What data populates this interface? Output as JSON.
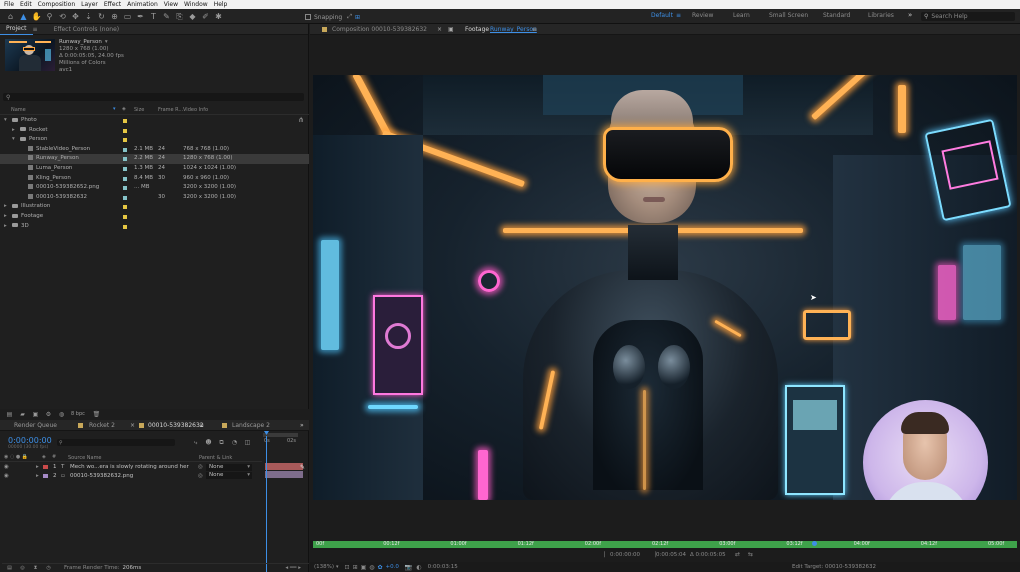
{
  "menu": [
    "File",
    "Edit",
    "Composition",
    "Layer",
    "Effect",
    "Animation",
    "View",
    "Window",
    "Help"
  ],
  "toolbar": {
    "snapping_label": "Snapping",
    "workspaces": [
      "Default",
      "Review",
      "Learn",
      "Small Screen",
      "Standard",
      "Libraries"
    ],
    "active_workspace": "Default",
    "search_placeholder": "Search Help"
  },
  "project": {
    "tabs": [
      "Project",
      "Effect Controls (none)"
    ],
    "preview": {
      "name": "Runway_Person",
      "details": [
        "1280 x 768 (1.00)",
        "Δ 0:00:05:05, 24.00 fps",
        "Millions of Colors",
        "avc1"
      ]
    },
    "search_placeholder": "",
    "columns": [
      "Name",
      "Size",
      "Frame R...",
      "Video Info"
    ],
    "rows": [
      {
        "name": "Photo",
        "type": "folder",
        "indent": 0,
        "size": "",
        "fps": "",
        "info": "",
        "color": "#e5c643"
      },
      {
        "name": "Rocket",
        "type": "folder",
        "indent": 1,
        "size": "",
        "fps": "",
        "info": "",
        "color": "#e5c643"
      },
      {
        "name": "Person",
        "type": "folder",
        "indent": 1,
        "size": "",
        "fps": "",
        "info": "",
        "color": "#e5c643"
      },
      {
        "name": "StableVideo_Person",
        "type": "file",
        "indent": 2,
        "size": "2.1 MB",
        "fps": "24",
        "info": "768 x 768 (1.00)",
        "color": "#86c3c8"
      },
      {
        "name": "Runway_Person",
        "type": "file",
        "indent": 2,
        "size": "2.2 MB",
        "fps": "24",
        "info": "1280 x 768 (1.00)",
        "color": "#86c3c8",
        "selected": true
      },
      {
        "name": "Luma_Person",
        "type": "file",
        "indent": 2,
        "size": "1.3 MB",
        "fps": "24",
        "info": "1024 x 1024 (1.00)",
        "color": "#86c3c8"
      },
      {
        "name": "Kling_Person",
        "type": "file",
        "indent": 2,
        "size": "8.4 MB",
        "fps": "30",
        "info": "960 x 960 (1.00)",
        "color": "#86c3c8"
      },
      {
        "name": "00010-539382652.png",
        "type": "file",
        "indent": 2,
        "size": "... MB",
        "fps": "",
        "info": "3200 x 3200 (1.00)",
        "color": "#86c3c8"
      },
      {
        "name": "00010-539382632",
        "type": "file",
        "indent": 2,
        "size": "",
        "fps": "30",
        "info": "3200 x 3200 (1.00)",
        "color": "#86c3c8"
      },
      {
        "name": "Illustration",
        "type": "folder",
        "indent": 0,
        "size": "",
        "fps": "",
        "info": "",
        "color": "#e5c643"
      },
      {
        "name": "Footage",
        "type": "folder",
        "indent": 0,
        "size": "",
        "fps": "",
        "info": "",
        "color": "#e5c643"
      },
      {
        "name": "3D",
        "type": "folder",
        "indent": 0,
        "size": "",
        "fps": "",
        "info": "",
        "color": "#e5c643"
      }
    ],
    "bpc_label": "8 bpc"
  },
  "timeline": {
    "tabs": [
      "Render Queue",
      "Rocket 2",
      "00010-539382632",
      "Landscape 2"
    ],
    "active_tab": "00010-539382632",
    "timecode": "0:00:00:00",
    "sub_timecode": "00000 (30.00 fps)",
    "columns": [
      "Source Name",
      "Parent & Link"
    ],
    "layers": [
      {
        "num": "1",
        "name": "Mech wo...era is slowly rotating around her",
        "parent": "None",
        "color": "#c94a4a"
      },
      {
        "num": "2",
        "name": "00010-539382632.png",
        "parent": "None",
        "color": "#a58ac6"
      }
    ],
    "ruler_labels": [
      "0s",
      "02s"
    ],
    "frame_render_label": "Frame Render Time:",
    "frame_render_value": "206ms"
  },
  "viewer": {
    "tabs": [
      {
        "label": "Composition 00010-539382632"
      },
      {
        "label": "Footage",
        "sub": "Runway_Person"
      }
    ],
    "ruler_labels": [
      "00f",
      "00:12f",
      "01:00f",
      "01:12f",
      "02:00f",
      "02:12f",
      "03:00f",
      "03:12f",
      "04:00f",
      "04:12f",
      "05:00f"
    ],
    "timecodes": [
      "0:00:00:00",
      "0:00:05:04",
      "Δ 0:00:05:05"
    ],
    "zoom": "(138%)",
    "offset": "+0.0",
    "current_time": "0:00:03:15",
    "edit_target": "Edit Target: 00010-539382632",
    "colors": {
      "accent": "#3d8fe6",
      "ruler_green": "#3ea14a"
    }
  }
}
